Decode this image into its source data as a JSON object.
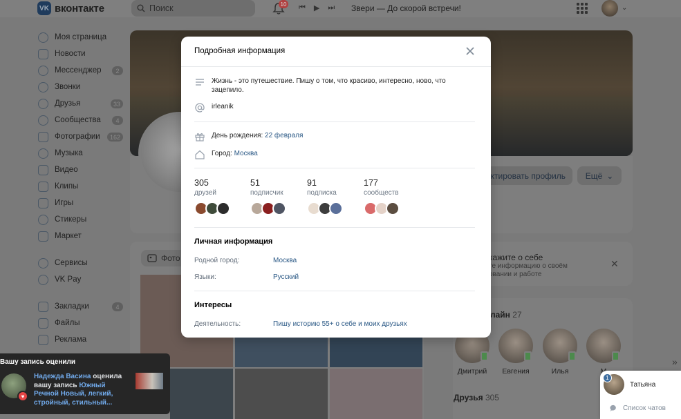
{
  "topbar": {
    "logo_mark": "VK",
    "logo_text": "вконтакте",
    "search_placeholder": "Поиск",
    "notifications_count": "10",
    "track": "Звери — До скорой встречи!"
  },
  "sidebar": {
    "items": [
      {
        "label": "Моя страница",
        "count": ""
      },
      {
        "label": "Новости",
        "count": ""
      },
      {
        "label": "Мессенджер",
        "count": "2"
      },
      {
        "label": "Звонки",
        "count": ""
      },
      {
        "label": "Друзья",
        "count": "33"
      },
      {
        "label": "Сообщества",
        "count": "4"
      },
      {
        "label": "Фотографии",
        "count": "162"
      },
      {
        "label": "Музыка",
        "count": ""
      },
      {
        "label": "Видео",
        "count": ""
      },
      {
        "label": "Клипы",
        "count": ""
      },
      {
        "label": "Игры",
        "count": ""
      },
      {
        "label": "Стикеры",
        "count": ""
      },
      {
        "label": "Маркет",
        "count": ""
      }
    ],
    "items2": [
      {
        "label": "Сервисы",
        "count": ""
      },
      {
        "label": "VK Pay",
        "count": ""
      }
    ],
    "items3": [
      {
        "label": "Закладки",
        "count": "4"
      },
      {
        "label": "Файлы",
        "count": ""
      },
      {
        "label": "Реклама",
        "count": ""
      }
    ]
  },
  "profile": {
    "edit_label": "ктировать профиль",
    "more_label": "Ещё",
    "photos_tab": "Фото",
    "about_title": "кажите о себе",
    "about_sub": "те информацию о своём овании и работе",
    "online_title": "лайн",
    "online_count": "27",
    "friends_title": "Друзья",
    "friends_count": "305",
    "online_friends": [
      "Дмитрий",
      "Евгения",
      "Илья",
      "М"
    ]
  },
  "modal": {
    "title": "Подробная информация",
    "status": "Жизнь - это путешествие. Пишу о том, что красиво, интересно, ново, что зацепило.",
    "nickname": "irleanik",
    "birthday_label": "День рождения:",
    "birthday_value": "22 февраля",
    "city_label": "Город:",
    "city_value": "Москва",
    "stats": [
      {
        "num": "305",
        "label": "друзей"
      },
      {
        "num": "51",
        "label": "подписчик"
      },
      {
        "num": "91",
        "label": "подписка"
      },
      {
        "num": "177",
        "label": "сообществ"
      }
    ],
    "personal_title": "Личная информация",
    "hometown_label": "Родной город:",
    "hometown_value": "Москва",
    "languages_label": "Языки:",
    "languages_value": "Русский",
    "interests_title": "Интересы",
    "activity_label": "Деятельность:",
    "activity_value": "Пишу историю 55+ о себе и моих друзьях"
  },
  "notification": {
    "title": "Вашу запись оценили",
    "author": "Надежда Васина",
    "action": " оценила вашу запись ",
    "post": "Южный Речной Новый, легкий, стройный, стильный..."
  },
  "chat": {
    "badge": "1",
    "name": "Татьяна",
    "list_label": "Список чатов"
  },
  "colors": {
    "link": "#2a5885",
    "notification_link": "#71aaeb",
    "heart": "#e64646"
  }
}
